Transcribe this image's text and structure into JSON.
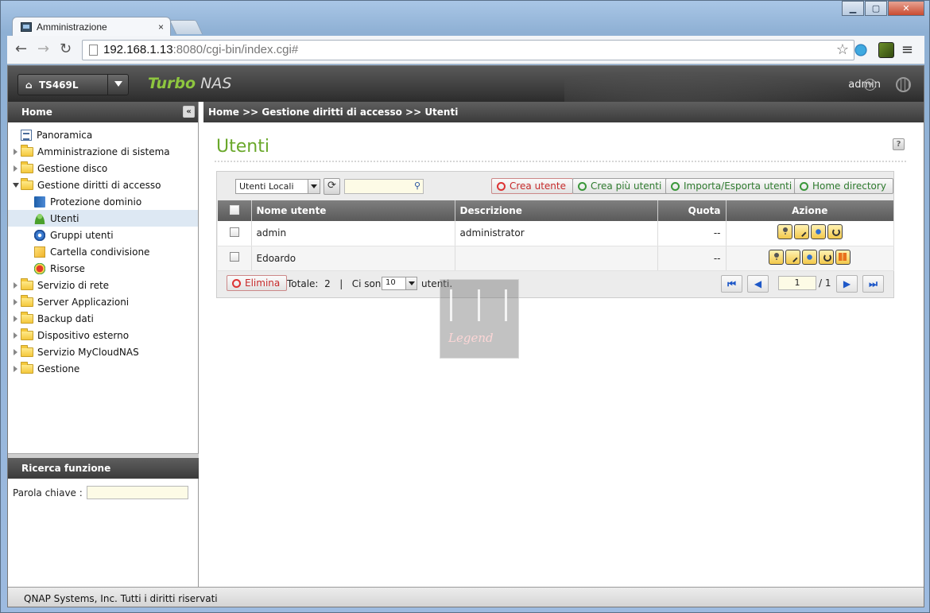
{
  "browser": {
    "tab_title": "Amministrazione",
    "tab_close": "×",
    "url_host": "192.168.1.13",
    "url_rest": ":8080/cgi-bin/index.cgi#",
    "window_controls": {
      "minimize": "▁",
      "maximize": "▢",
      "close": "✕"
    }
  },
  "header": {
    "model": "TS469L",
    "brand_turbo": "Turbo",
    "brand_nas": "NAS",
    "user": "admin"
  },
  "sidebar": {
    "title": "Home",
    "collapse_icon": "«",
    "items": [
      {
        "label": "Panoramica",
        "icon": "panoramica-icon"
      },
      {
        "label": "Amministrazione di sistema",
        "icon": "folder-icon"
      },
      {
        "label": "Gestione disco",
        "icon": "folder-icon"
      },
      {
        "label": "Gestione diritti di accesso",
        "icon": "folder-open-icon"
      },
      {
        "label": "Protezione dominio",
        "icon": "domain-icon"
      },
      {
        "label": "Utenti",
        "icon": "user-icon"
      },
      {
        "label": "Gruppi utenti",
        "icon": "group-icon"
      },
      {
        "label": "Cartella condivisione",
        "icon": "share-folder-icon"
      },
      {
        "label": "Risorse",
        "icon": "resources-icon"
      },
      {
        "label": "Servizio di rete",
        "icon": "folder-icon"
      },
      {
        "label": "Server Applicazioni",
        "icon": "folder-icon"
      },
      {
        "label": "Backup dati",
        "icon": "folder-icon"
      },
      {
        "label": "Dispositivo esterno",
        "icon": "folder-icon"
      },
      {
        "label": "Servizio MyCloudNAS",
        "icon": "folder-icon"
      },
      {
        "label": "Gestione",
        "icon": "folder-icon"
      }
    ]
  },
  "search_panel": {
    "title": "Ricerca funzione",
    "keyword_label": "Parola chiave :"
  },
  "footer": {
    "copyright": "QNAP Systems, Inc. Tutti i diritti riservati"
  },
  "content": {
    "breadcrumb": "Home >> Gestione diritti di accesso >> Utenti",
    "title": "Utenti",
    "help_icon": "?",
    "toolbar": {
      "filter_value": "Utenti Locali",
      "refresh_icon": "⟳",
      "search_icon": "🔍",
      "create_user": "Crea utente",
      "create_multiple": "Crea più utenti",
      "import_export": "Importa/Esporta utenti",
      "home_directory": "Home directory"
    },
    "table": {
      "headers": [
        "Nome utente",
        "Descrizione",
        "Quota",
        "Azione"
      ],
      "rows": [
        {
          "name": "admin",
          "description": "administrator",
          "quota": "--"
        },
        {
          "name": "Edoardo",
          "description": "",
          "quota": "--"
        }
      ]
    },
    "pager": {
      "delete": "Elimina",
      "total_label": "Totale:",
      "total": "2",
      "sep": "|",
      "per_page_label": "Ci sono",
      "per_page": "10",
      "per_page_suffix": "utenti.",
      "first": "⏮",
      "prev": "◀",
      "next": "▶",
      "last": "⏭",
      "current_page": "1",
      "of": "/ 1"
    }
  },
  "watermark": {
    "text": "Legend"
  }
}
